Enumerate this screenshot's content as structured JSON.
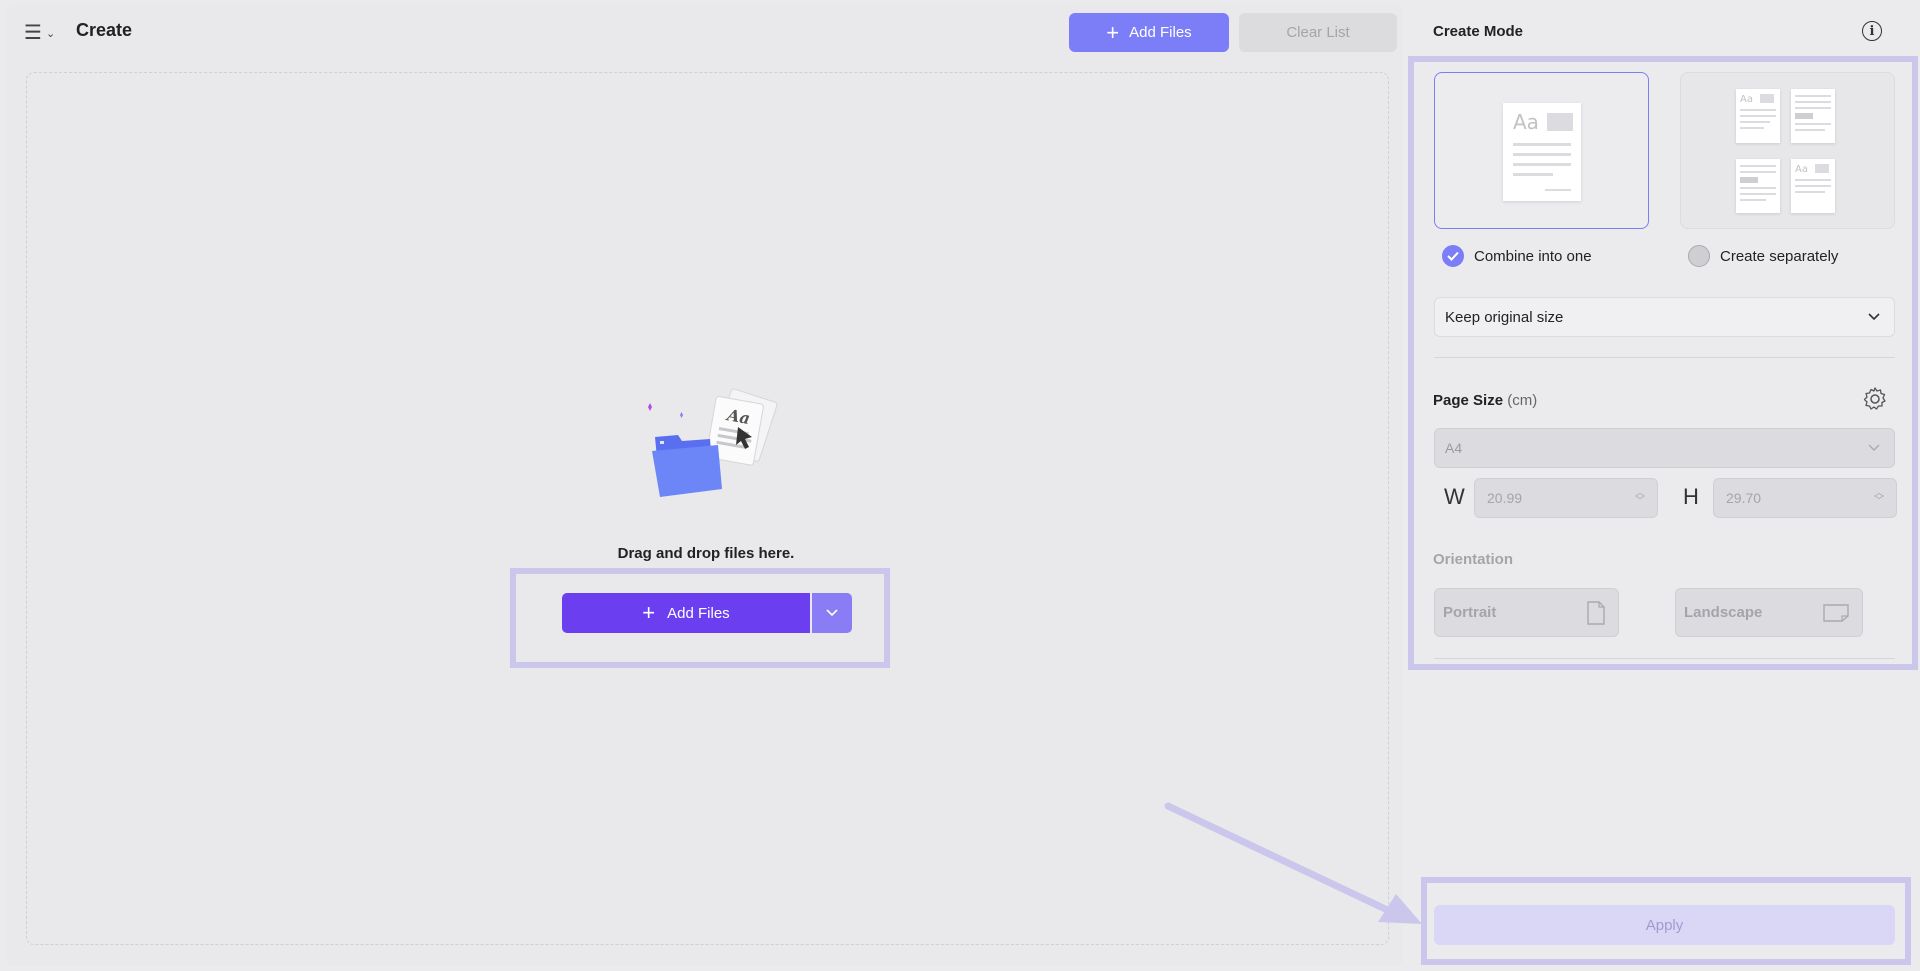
{
  "header": {
    "title": "Create",
    "add_files_label": "Add Files",
    "clear_list_label": "Clear List"
  },
  "drop_zone": {
    "text": "Drag and drop files here.",
    "add_files_label": "Add Files"
  },
  "create_mode": {
    "title": "Create Mode",
    "options": [
      {
        "label": "Combine into one",
        "selected": true
      },
      {
        "label": "Create separately",
        "selected": false
      }
    ],
    "size_option": "Keep original size"
  },
  "page_size": {
    "title": "Page Size",
    "unit": "(cm)",
    "preset": "A4",
    "width_label": "W",
    "width_value": "20.99",
    "height_label": "H",
    "height_value": "29.70"
  },
  "orientation": {
    "title": "Orientation",
    "portrait_label": "Portrait",
    "landscape_label": "Landscape"
  },
  "apply_label": "Apply",
  "colors": {
    "accent": "#7b7ef6",
    "primary": "#6b3ff0",
    "highlight": "#cbc6ec"
  }
}
